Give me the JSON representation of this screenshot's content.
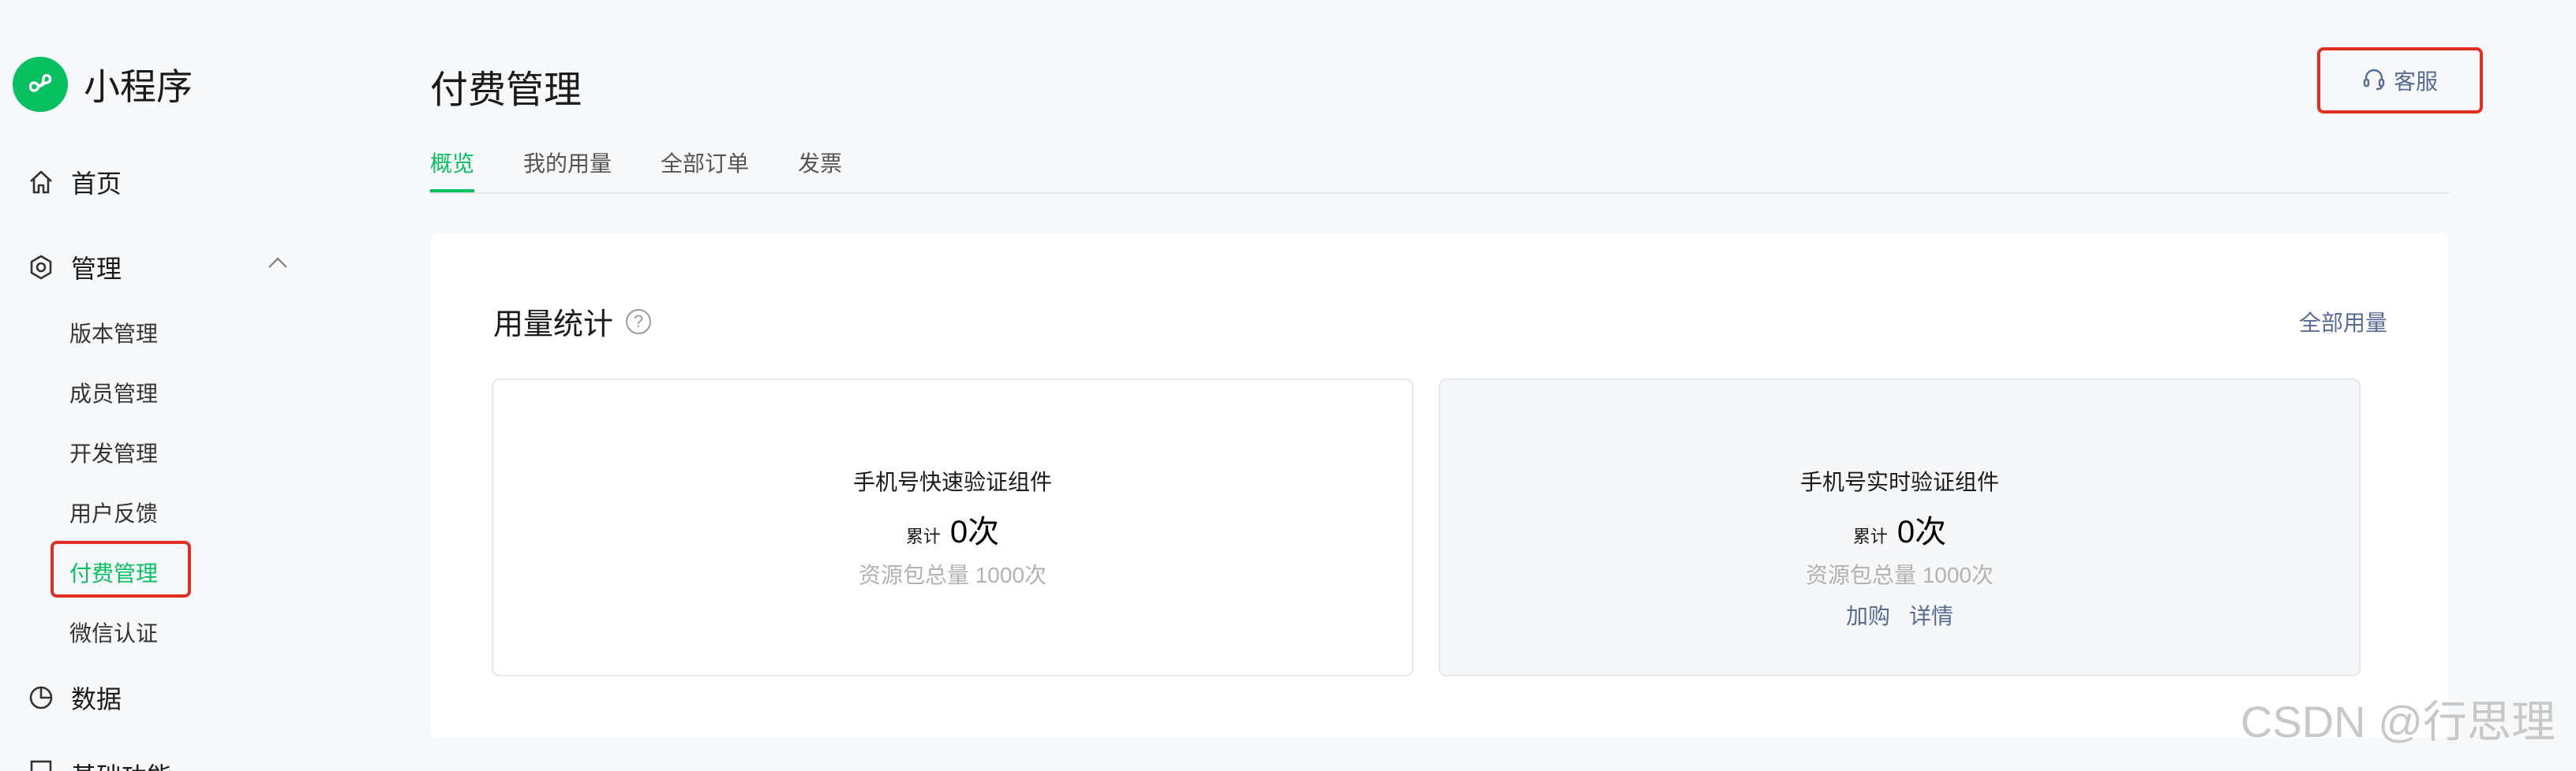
{
  "app": {
    "name": "小程序"
  },
  "sidebar": {
    "home": "首页",
    "manage": "管理",
    "manage_items": [
      "版本管理",
      "成员管理",
      "开发管理",
      "用户反馈",
      "付费管理",
      "微信认证"
    ],
    "data": "数据",
    "next_cut": "基础功能"
  },
  "header": {
    "title": "付费管理",
    "service": "客服"
  },
  "tabs": [
    "概览",
    "我的用量",
    "全部订单",
    "发票"
  ],
  "usage": {
    "title": "用量统计",
    "help": "?",
    "all_link": "全部用量",
    "items": [
      {
        "name": "手机号快速验证组件",
        "prefix": "累计",
        "count": "0次",
        "pack": "资源包总量 1000次"
      },
      {
        "name": "手机号实时验证组件",
        "prefix": "累计",
        "count": "0次",
        "pack": "资源包总量 1000次",
        "links": [
          "加购",
          "详情"
        ]
      }
    ]
  },
  "watermark": "CSDN @行思理",
  "colors": {
    "accent": "#07c160",
    "link": "#576b95",
    "highlight": "#e02e24"
  }
}
